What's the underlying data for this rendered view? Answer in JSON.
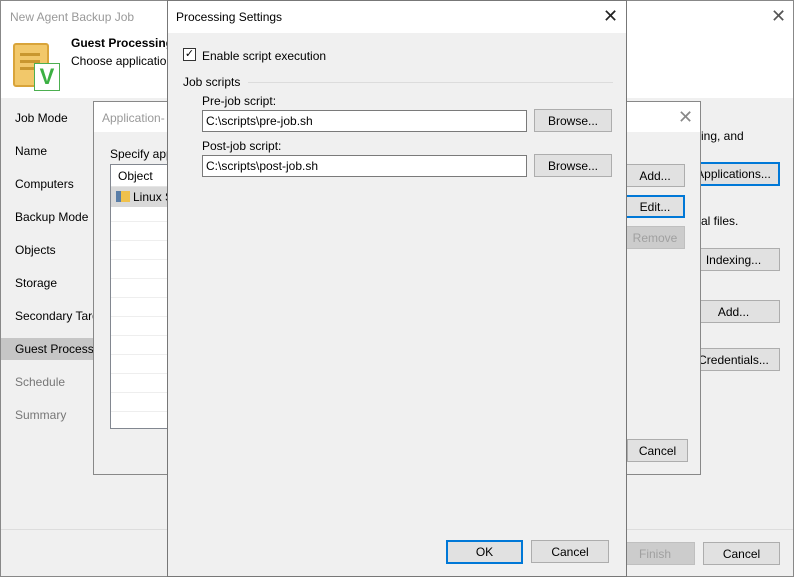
{
  "main": {
    "title": "New Agent Backup Job",
    "header_title": "Guest Processing",
    "header_subtitle": "Choose application",
    "sidebar": [
      "Job Mode",
      "Name",
      "Computers",
      "Backup Mode",
      "Objects",
      "Storage",
      "Secondary Targ",
      "Guest Processing",
      "Schedule",
      "Summary"
    ],
    "text1": "ing, and",
    "text2": "al files.",
    "applications_label": "Applications...",
    "indexing_label": "Indexing...",
    "add_label": "Add...",
    "credentials_label": "Credentials...",
    "finish_label": "Finish",
    "cancel_label": "Cancel"
  },
  "app_dialog": {
    "title": "Application-",
    "specify": "Specify app",
    "column": "Object",
    "row": "Linux S",
    "add_label": "Add...",
    "edit_label": "Edit...",
    "remove_label": "Remove",
    "cancel_label": "Cancel"
  },
  "proc": {
    "title": "Processing Settings",
    "enable_label": "Enable script execution",
    "enable_checked": true,
    "group": "Job scripts",
    "pre_label": "Pre-job script:",
    "pre_value": "C:\\scripts\\pre-job.sh",
    "post_label": "Post-job script:",
    "post_value": "C:\\scripts\\post-job.sh",
    "browse_label": "Browse...",
    "ok_label": "OK",
    "cancel_label": "Cancel"
  }
}
